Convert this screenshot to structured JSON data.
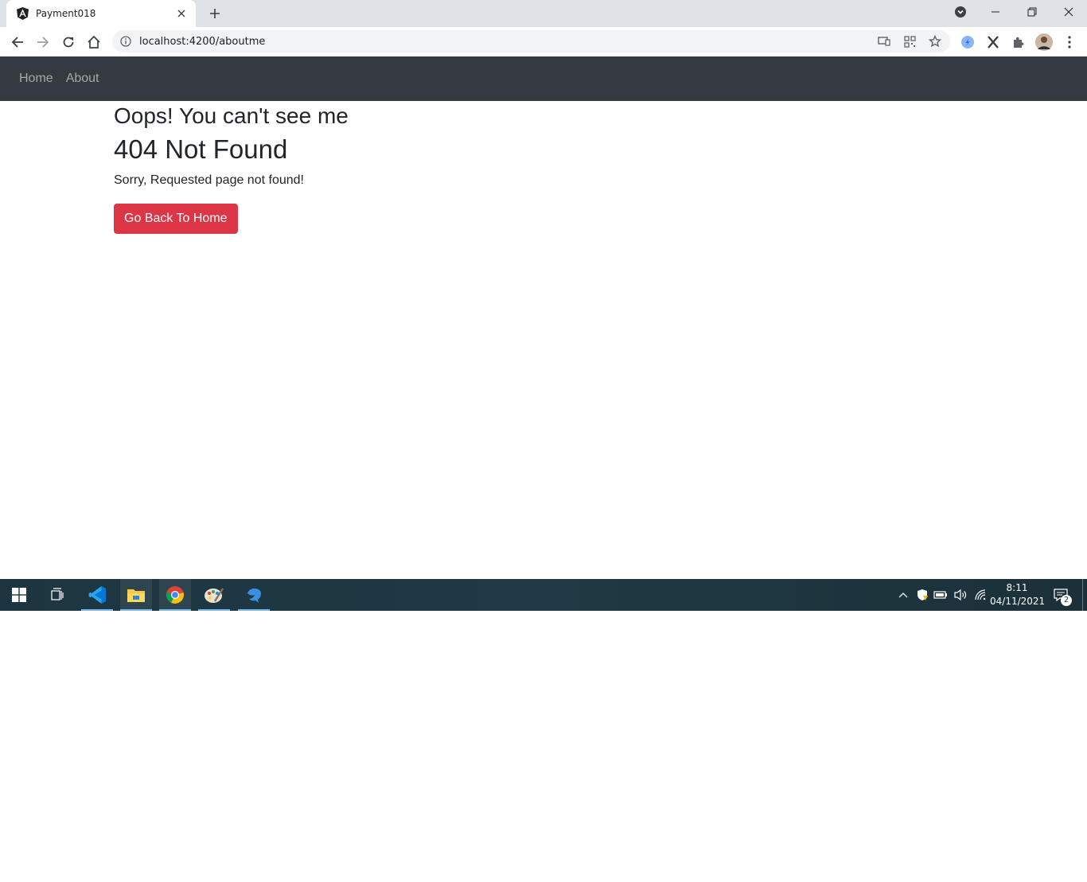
{
  "browser": {
    "tab": {
      "title": "Payment018",
      "favicon": "angular-icon"
    },
    "url": "localhost:4200/aboutme"
  },
  "navbar": {
    "links": [
      {
        "label": "Home"
      },
      {
        "label": "About"
      }
    ]
  },
  "main": {
    "heading": "Oops! You can't see me",
    "title": "404 Not Found",
    "message": "Sorry, Requested page not found!",
    "button_label": "Go Back To Home",
    "button_color": "#dc3545"
  },
  "taskbar": {
    "apps": [
      "vscode-icon",
      "file-explorer-icon",
      "chrome-icon",
      "paint-icon",
      "dolphin-icon"
    ],
    "clock": {
      "time": "8:11",
      "date": "04/11/2021"
    },
    "notification_count": "2"
  },
  "colors": {
    "navbar_bg": "#343a40",
    "taskbar_bg": "#1f3a44"
  }
}
